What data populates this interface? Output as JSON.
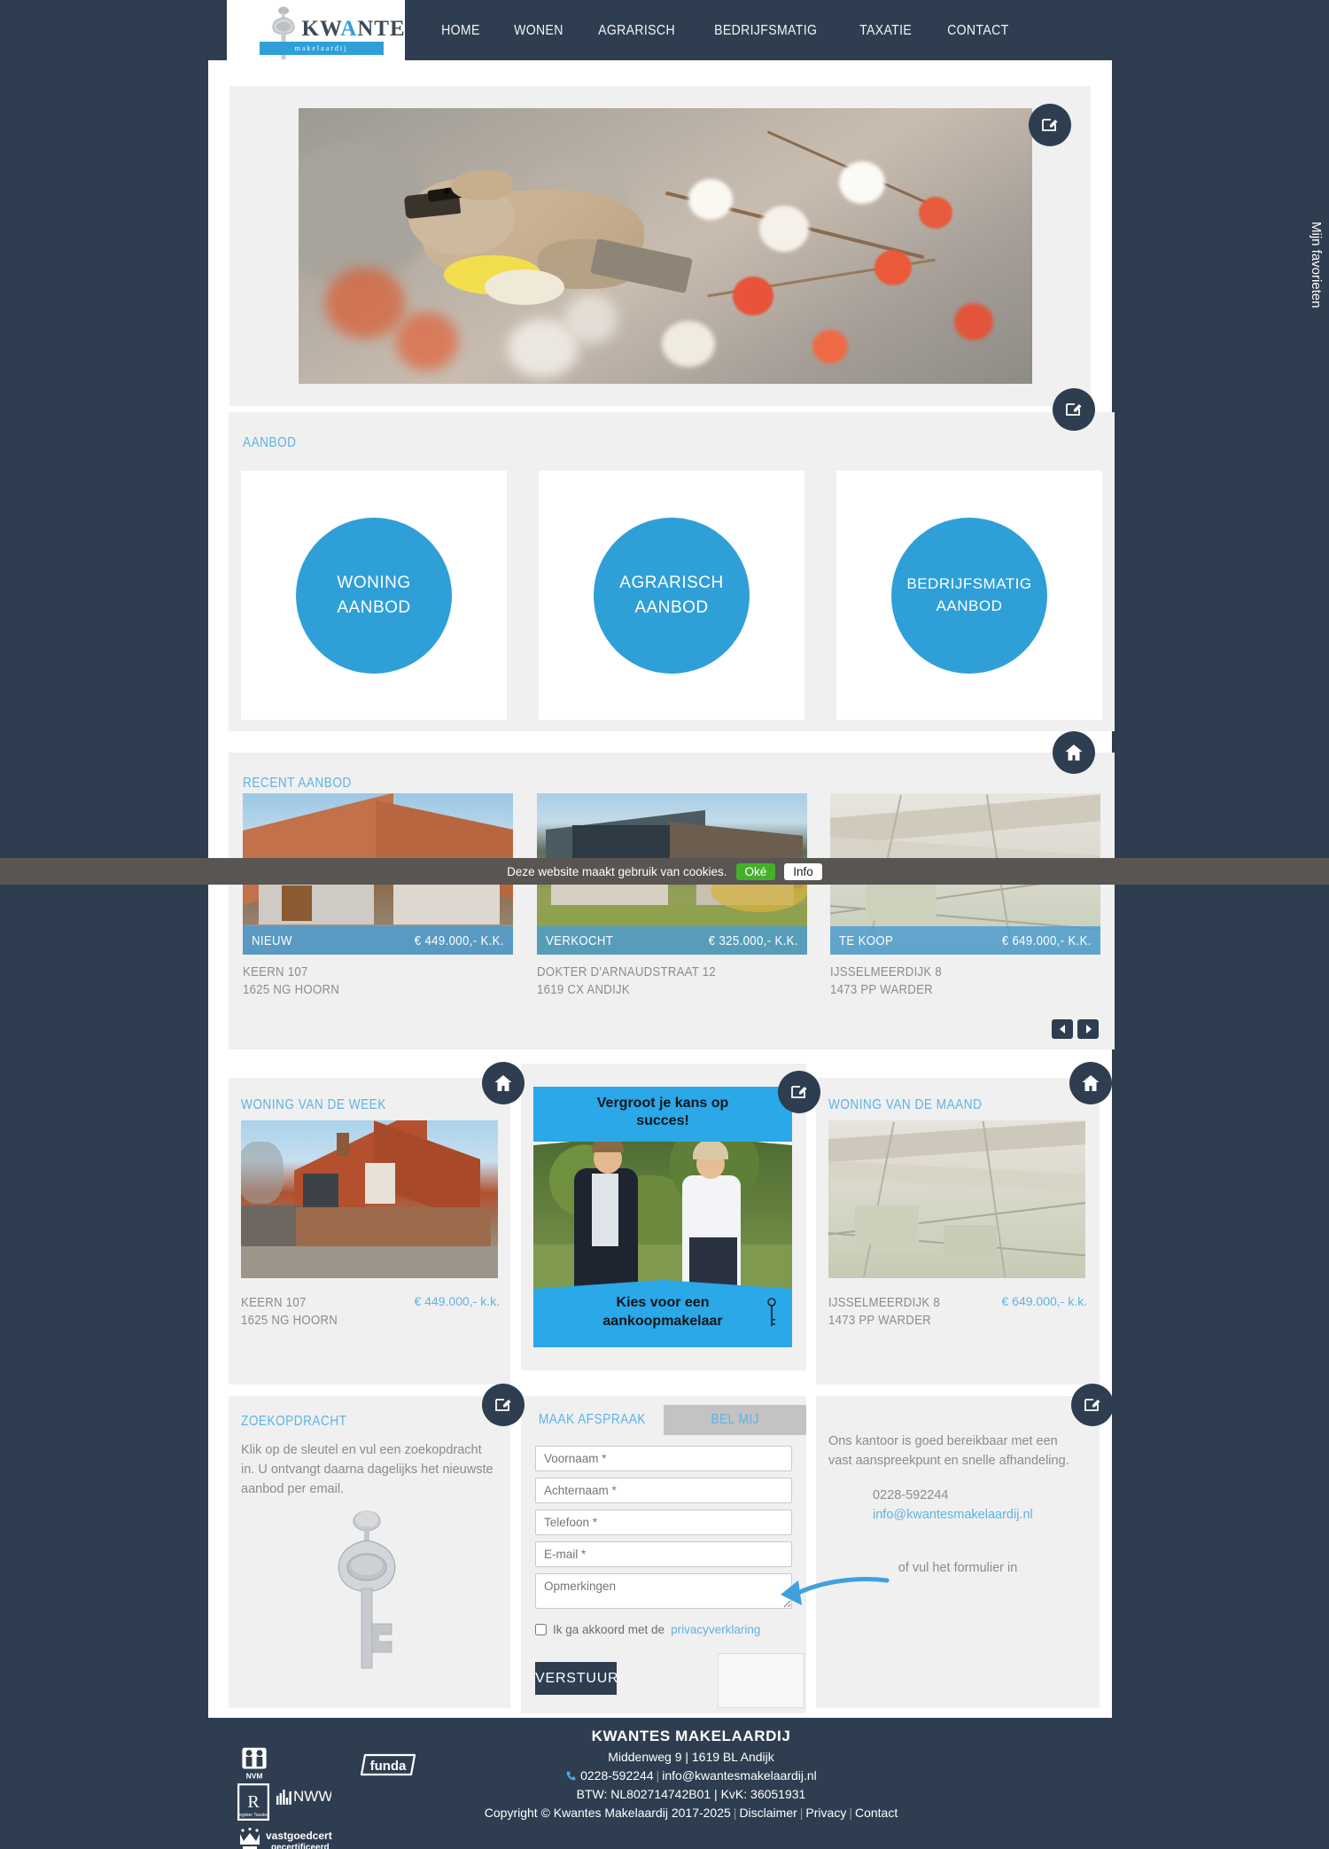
{
  "header": {
    "logo": {
      "word_part1": "KW",
      "word_part2": "A",
      "word_part3": "NTES",
      "subtitle": "makelaardij"
    },
    "nav": [
      {
        "label": "HOME"
      },
      {
        "label": "WONEN"
      },
      {
        "label": "AGRARISCH"
      },
      {
        "label": "BEDRIJFSMATIG"
      },
      {
        "label": "TAXATIE"
      },
      {
        "label": "CONTACT"
      }
    ]
  },
  "favorites": {
    "label": "Mijn favorieten"
  },
  "aanbod": {
    "title": "AANBOD",
    "cards": [
      {
        "line1": "WONING",
        "line2": "AANBOD"
      },
      {
        "line1": "AGRARISCH",
        "line2": "AANBOD"
      },
      {
        "line1": "BEDRIJFSMATIG",
        "line2": "AANBOD"
      }
    ]
  },
  "recent": {
    "title": "RECENT AANBOD",
    "properties": [
      {
        "status": "NIEUW",
        "price": "€ 449.000,- K.K.",
        "street": "KEERN 107",
        "city": "1625 NG HOORN"
      },
      {
        "status": "VERKOCHT",
        "price": "€ 325.000,- K.K.",
        "street": "DOKTER D'ARNAUDSTRAAT 12",
        "city": "1619 CX ANDIJK"
      },
      {
        "status": "TE KOOP",
        "price": "€ 649.000,- K.K.",
        "street": "IJSSELMEERDIJK 8",
        "city": "1473 PP WARDER"
      }
    ],
    "prev_label": "◀",
    "next_label": "▶"
  },
  "week": {
    "title": "WONING VAN DE WEEK",
    "street": "KEERN 107",
    "city": "1625 NG HOORN",
    "price": "€ 449.000,- k.k."
  },
  "promo": {
    "top_line1": "Vergroot je  kans op",
    "top_line2": "succes!",
    "bottom_line1": "Kies voor een",
    "bottom_line2": "aankoopmakelaar"
  },
  "month": {
    "title": "WONING VAN DE MAAND",
    "street": "IJSSELMEERDIJK 8",
    "city": "1473 PP WARDER",
    "price": "€ 649.000,- k.k."
  },
  "zoekopdracht": {
    "title": "ZOEKOPDRACHT",
    "text": "Klik op de sleutel en vul een zoekopdracht in. U ontvangt daarna dagelijks het nieuwste aanbod per email."
  },
  "form": {
    "tab_active": "MAAK AFSPRAAK",
    "tab_inactive": "BEL MIJ",
    "fields": [
      {
        "placeholder": "Voornaam *",
        "value": ""
      },
      {
        "placeholder": "Achternaam *",
        "value": ""
      },
      {
        "placeholder": "Telefoon *",
        "value": ""
      },
      {
        "placeholder": "E-mail *",
        "value": ""
      }
    ],
    "textarea_placeholder": "Opmerkingen",
    "privacy_text": "Ik ga akkoord met de",
    "privacy_link": "privacyverklaring",
    "submit_label": "VERSTUUR"
  },
  "contact": {
    "text": "Ons kantoor is goed bereikbaar met een vast aanspreekpunt en snelle afhandeling.",
    "phone": "0228-592244",
    "email": "info@kwantesmakelaardij.nl",
    "note": "of vul het formulier in"
  },
  "cookie": {
    "text": "Deze website maakt gebruik van cookies.",
    "ok_label": "Oké",
    "info_label": "Info"
  },
  "footer": {
    "company": "KWANTES MAKELAARDIJ",
    "address": "Middenweg 9 | 1619 BL Andijk",
    "phone": "0228-592244",
    "email": "info@kwantesmakelaardij.nl",
    "registration": "BTW: NL802714742B01 | KvK: 36051931",
    "copyright": "Copyright © Kwantes Makelaardij 2017-2025",
    "links": [
      {
        "label": "Disclaimer"
      },
      {
        "label": "Privacy"
      },
      {
        "label": "Contact"
      }
    ],
    "logos": [
      {
        "label": "NVM"
      },
      {
        "label": "NWWI"
      },
      {
        "label": "funda"
      },
      {
        "label": "vastgoedcert"
      },
      {
        "label": "gecertificeerd"
      }
    ]
  },
  "colors": {
    "brand_dark": "#2e3e50",
    "brand_blue": "#2f9fd8",
    "title_blue": "#5fb3e4",
    "panel_grey": "#f0f0f0"
  }
}
